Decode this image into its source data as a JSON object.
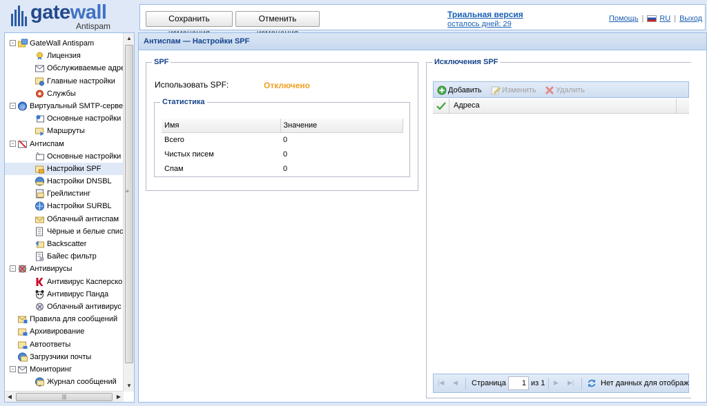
{
  "logo": {
    "brand_pre": "gate",
    "brand_post": "wall",
    "sub": "Antispam"
  },
  "toolbar": {
    "save_label": "Сохранить изменения",
    "cancel_label": "Отменить изменения"
  },
  "trial": {
    "title": "Триальная версия",
    "days": "осталось дней: 29"
  },
  "toplinks": {
    "help": "Помощь",
    "lang": "RU",
    "logout": "Выход"
  },
  "tree": {
    "items": [
      {
        "label": "GateWall Antispam",
        "level": 1,
        "expander": "-",
        "icon": "app-icon"
      },
      {
        "label": "Лицензия",
        "level": 2,
        "icon": "license-icon"
      },
      {
        "label": "Обслуживаемые адреса",
        "level": 2,
        "icon": "addresses-icon"
      },
      {
        "label": "Главные настройки",
        "level": 2,
        "icon": "settings-icon"
      },
      {
        "label": "Службы",
        "level": 2,
        "icon": "services-icon"
      },
      {
        "label": "Виртуальный SMTP-сервер",
        "level": 1,
        "expander": "-",
        "icon": "smtp-icon"
      },
      {
        "label": "Основные настройки",
        "level": 2,
        "icon": "smtp-settings-icon"
      },
      {
        "label": "Маршруты",
        "level": 2,
        "icon": "routes-icon"
      },
      {
        "label": "Антиспам",
        "level": 1,
        "expander": "-",
        "icon": "antispam-icon"
      },
      {
        "label": "Основные настройки",
        "level": 2,
        "icon": "antispam-settings-icon"
      },
      {
        "label": "Настройки SPF",
        "level": 2,
        "icon": "spf-icon",
        "selected": true
      },
      {
        "label": "Настройки DNSBL",
        "level": 2,
        "icon": "dnsbl-icon"
      },
      {
        "label": "Грейлистинг",
        "level": 2,
        "icon": "greylisting-icon"
      },
      {
        "label": "Настройки SURBL",
        "level": 2,
        "icon": "surbl-icon"
      },
      {
        "label": "Облачный антиспам",
        "level": 2,
        "icon": "cloud-antispam-icon"
      },
      {
        "label": "Чёрные и белые списки",
        "level": 2,
        "icon": "lists-icon"
      },
      {
        "label": "Backscatter",
        "level": 2,
        "icon": "backscatter-icon"
      },
      {
        "label": "Байес фильтр",
        "level": 2,
        "icon": "bayes-icon"
      },
      {
        "label": "Антивирусы",
        "level": 1,
        "expander": "-",
        "icon": "antivirus-icon"
      },
      {
        "label": "Антивирус Касперского",
        "level": 2,
        "icon": "kaspersky-icon"
      },
      {
        "label": "Антивирус Панда",
        "level": 2,
        "icon": "panda-icon"
      },
      {
        "label": "Облачный антивирус",
        "level": 2,
        "icon": "cloud-antivirus-icon"
      },
      {
        "label": "Правила для сообщений",
        "level": 1,
        "icon": "rules-icon"
      },
      {
        "label": "Архивирование",
        "level": 1,
        "icon": "archive-icon"
      },
      {
        "label": "Автоответы",
        "level": 1,
        "icon": "autoreply-icon"
      },
      {
        "label": "Загрузчики почты",
        "level": 1,
        "icon": "mail-loader-icon"
      },
      {
        "label": "Мониторинг",
        "level": 1,
        "expander": "-",
        "icon": "monitoring-icon"
      },
      {
        "label": "Журнал сообщений",
        "level": 2,
        "icon": "message-log-icon"
      }
    ]
  },
  "main": {
    "title": "Антиспам — Настройки SPF",
    "spf": {
      "legend": "SPF",
      "use_label": "Использовать SPF:",
      "use_value": "Отключено",
      "stats": {
        "legend": "Статистика",
        "columns": [
          "Имя",
          "Значение"
        ],
        "rows": [
          [
            "Всего",
            "0"
          ],
          [
            "Чистых писем",
            "0"
          ],
          [
            "Спам",
            "0"
          ]
        ]
      }
    },
    "exclusions": {
      "legend": "Исключения SPF",
      "add": "Добавить",
      "edit": "Изменить",
      "delete": "Удалить",
      "column": "Адреса",
      "pager": {
        "page_label": "Страница",
        "page": "1",
        "of": "из 1",
        "status": "Нет данных для отображения"
      }
    }
  },
  "colors": {
    "accent": "#15428b",
    "disabled_value": "#f0a020",
    "link": "#1a5fb4",
    "border": "#99bbe8"
  }
}
